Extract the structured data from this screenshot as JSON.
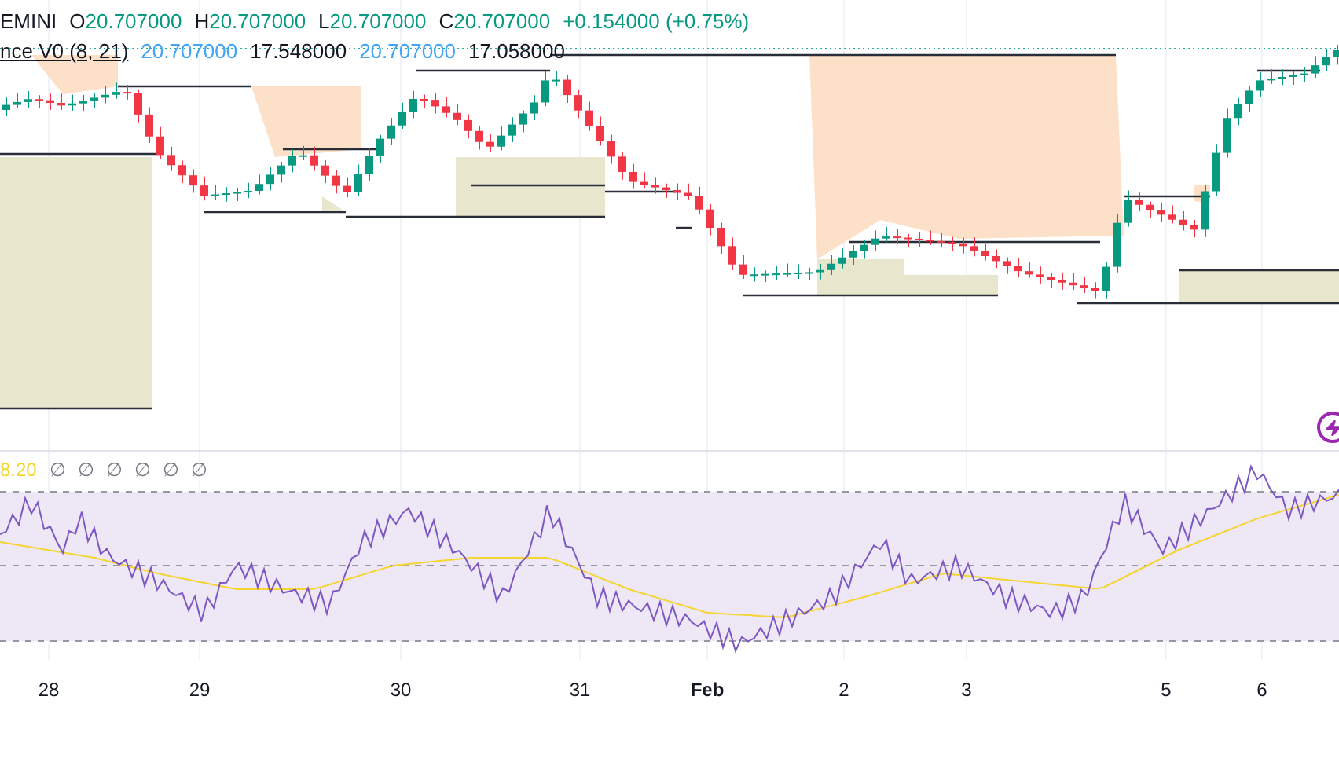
{
  "legend": {
    "symbol": "EMINI",
    "ohlc": [
      {
        "label": "O",
        "value": "20.707000"
      },
      {
        "label": "H",
        "value": "20.707000"
      },
      {
        "label": "L",
        "value": "20.707000"
      },
      {
        "label": "C",
        "value": "20.707000"
      }
    ],
    "change": "+0.154000 (+0.75%)",
    "indicator": {
      "name": "nce V0 (8, 21)",
      "values": [
        {
          "text": "20.707000",
          "kind": "highlight"
        },
        {
          "text": "17.548000",
          "kind": "plain"
        },
        {
          "text": "20.707000",
          "kind": "highlight"
        },
        {
          "text": "17.058000",
          "kind": "plain"
        }
      ]
    }
  },
  "rsi_legend": {
    "value": "8.20",
    "empty_values": [
      "∅",
      "∅",
      "∅",
      "∅",
      "∅",
      "∅"
    ]
  },
  "x_axis": {
    "labels": [
      {
        "text": "28",
        "bold": false
      },
      {
        "text": "29",
        "bold": false
      },
      {
        "text": "30",
        "bold": false
      },
      {
        "text": "31",
        "bold": false
      },
      {
        "text": "Feb",
        "bold": true
      },
      {
        "text": "2",
        "bold": false
      },
      {
        "text": "3",
        "bold": false
      },
      {
        "text": "5",
        "bold": false
      },
      {
        "text": "6",
        "bold": false
      }
    ]
  }
}
